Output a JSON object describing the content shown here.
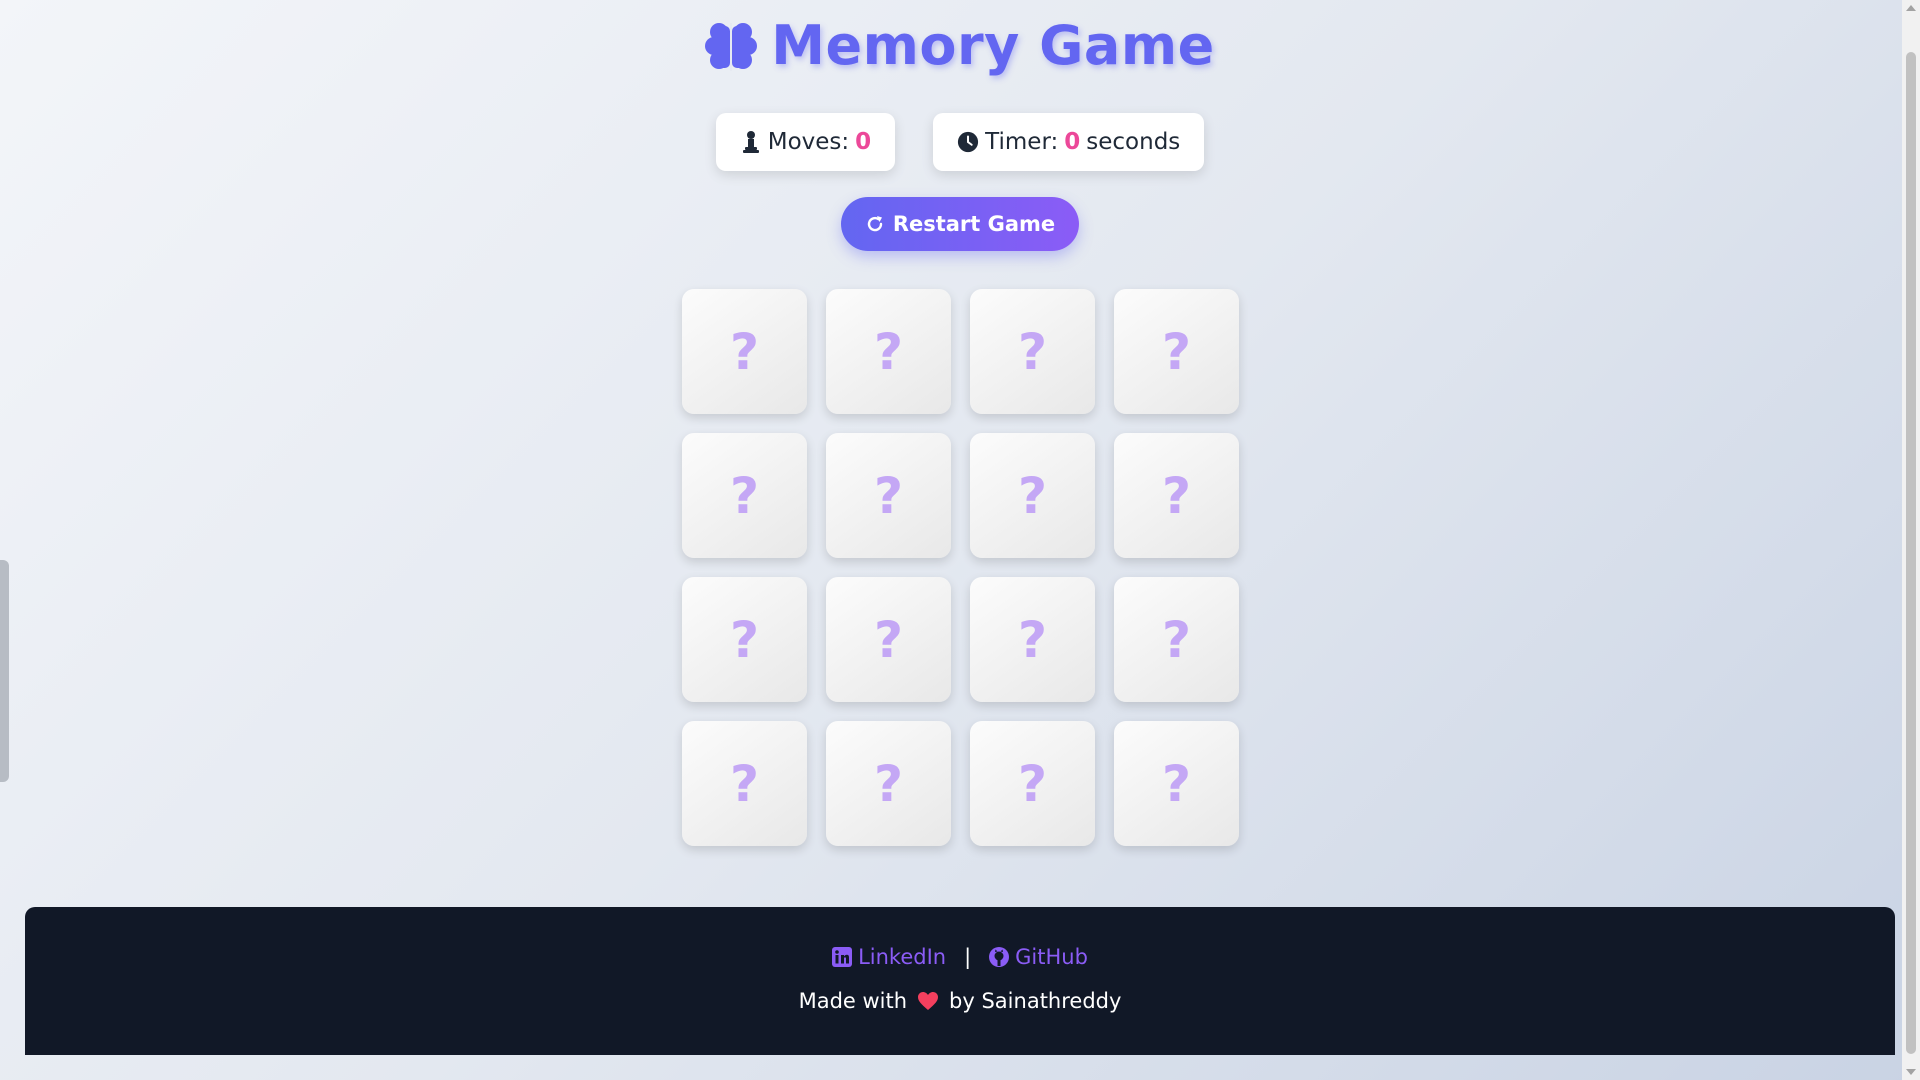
{
  "header": {
    "title": "Memory Game",
    "icon": "brain-icon"
  },
  "stats": {
    "moves": {
      "label": "Moves:",
      "value": "0",
      "icon": "chess-pawn-icon"
    },
    "timer": {
      "label": "Timer:",
      "value": "0",
      "unit": "seconds",
      "icon": "clock-icon"
    }
  },
  "restart": {
    "label": "Restart Game",
    "icon": "rotate-icon"
  },
  "board": {
    "cards": [
      {
        "face": "?"
      },
      {
        "face": "?"
      },
      {
        "face": "?"
      },
      {
        "face": "?"
      },
      {
        "face": "?"
      },
      {
        "face": "?"
      },
      {
        "face": "?"
      },
      {
        "face": "?"
      },
      {
        "face": "?"
      },
      {
        "face": "?"
      },
      {
        "face": "?"
      },
      {
        "face": "?"
      },
      {
        "face": "?"
      },
      {
        "face": "?"
      },
      {
        "face": "?"
      },
      {
        "face": "?"
      }
    ]
  },
  "footer": {
    "linkedin": {
      "label": "LinkedIn",
      "icon": "linkedin-icon"
    },
    "separator": "|",
    "github": {
      "label": "GitHub",
      "icon": "github-icon"
    },
    "made_with": "Made with",
    "by": "by Sainathreddy",
    "heart_icon": "heart-icon"
  },
  "colors": {
    "accent": "#6366f1",
    "accent2": "#8b5cf6",
    "highlight": "#ec4899",
    "footer_bg": "#111827",
    "card_mark": "#c4a7f5"
  }
}
